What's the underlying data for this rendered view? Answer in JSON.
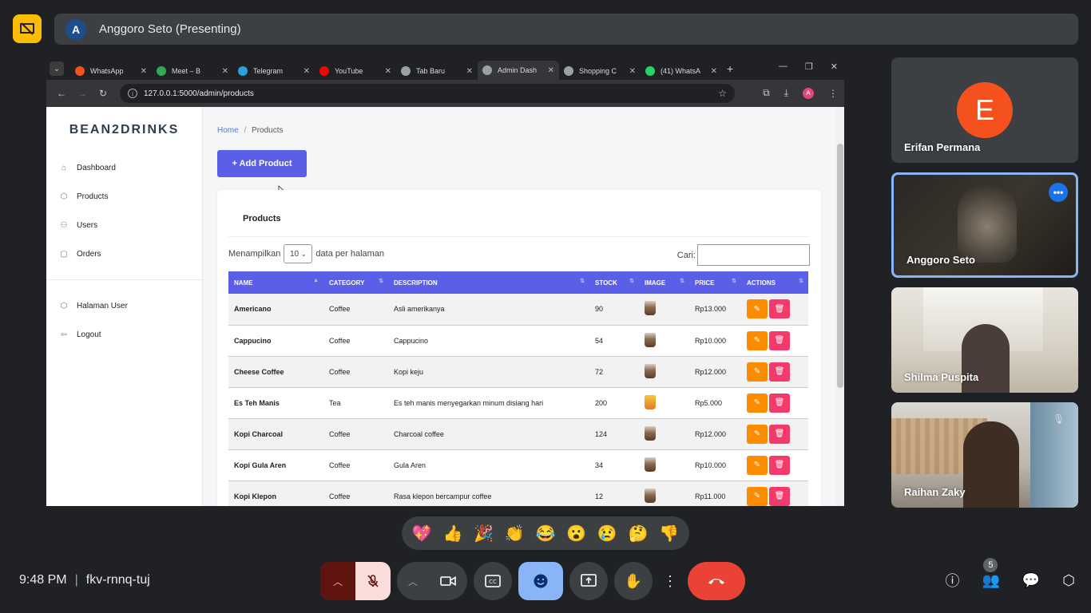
{
  "meet": {
    "presenter_initial": "A",
    "presenter_label": "Anggoro Seto (Presenting)",
    "time": "9:48 PM",
    "meeting_code": "fkv-rnnq-tuj",
    "people_count": "5"
  },
  "browser": {
    "tabs": [
      {
        "title": "WhatsApp",
        "color": "#f4511e"
      },
      {
        "title": "Meet – B",
        "color": "#34a853"
      },
      {
        "title": "Telegram",
        "color": "#2aa1da"
      },
      {
        "title": "YouTube",
        "color": "#ff0000"
      },
      {
        "title": "Tab Baru",
        "color": "#9aa0a6"
      },
      {
        "title": "Admin Dash",
        "color": "#9aa0a6",
        "active": true
      },
      {
        "title": "Shopping C",
        "color": "#9aa0a6"
      },
      {
        "title": "(41) WhatsA",
        "color": "#25d366"
      }
    ],
    "url": "127.0.0.1:5000/admin/products",
    "profile_initial": "A"
  },
  "admin": {
    "brand": "BEAN2DRINKS",
    "sidebar": {
      "items": [
        {
          "label": "Dashboard",
          "icon": "home-icon"
        },
        {
          "label": "Products",
          "icon": "box-icon"
        },
        {
          "label": "Users",
          "icon": "users-icon"
        },
        {
          "label": "Orders",
          "icon": "bag-icon"
        }
      ],
      "bottom_items": [
        {
          "label": "Halaman User",
          "icon": "box-icon"
        },
        {
          "label": "Logout",
          "icon": "logout-icon"
        }
      ]
    },
    "breadcrumb": {
      "home": "Home",
      "sep": "/",
      "current": "Products"
    },
    "add_button": "+ Add Product",
    "card_title": "Products",
    "length_prefix": "Menampilkan",
    "length_value": "10",
    "length_suffix": "data per halaman",
    "search_label": "Cari:",
    "table": {
      "headers": [
        "NAME",
        "CATEGORY",
        "DESCRIPTION",
        "STOCK",
        "IMAGE",
        "PRICE",
        "ACTIONS"
      ],
      "rows": [
        {
          "name": "Americano",
          "category": "Coffee",
          "description": "Asli amerikanya",
          "stock": "90",
          "price": "Rp13.000"
        },
        {
          "name": "Cappucino",
          "category": "Coffee",
          "description": "Cappucino",
          "stock": "54",
          "price": "Rp10.000"
        },
        {
          "name": "Cheese Coffee",
          "category": "Coffee",
          "description": "Kopi keju",
          "stock": "72",
          "price": "Rp12.000"
        },
        {
          "name": "Es Teh Manis",
          "category": "Tea",
          "description": "Es teh manis menyegarkan minum disiang hari",
          "stock": "200",
          "price": "Rp5.000"
        },
        {
          "name": "Kopi Charcoal",
          "category": "Coffee",
          "description": "Charcoal coffee",
          "stock": "124",
          "price": "Rp12.000"
        },
        {
          "name": "Kopi Gula Aren",
          "category": "Coffee",
          "description": "Gula Aren",
          "stock": "34",
          "price": "Rp10.000"
        },
        {
          "name": "Kopi Klepon",
          "category": "Coffee",
          "description": "Rasa klepon bercampur coffee",
          "stock": "12",
          "price": "Rp11.000"
        }
      ]
    }
  },
  "participants": [
    {
      "name": "Erifan Permana",
      "initial": "E"
    },
    {
      "name": "Anggoro Seto"
    },
    {
      "name": "Shilma Puspita"
    },
    {
      "name": "Raihan Zaky"
    }
  ],
  "reactions": [
    "💖",
    "👍",
    "🎉",
    "👏",
    "😂",
    "😮",
    "😢",
    "🤔",
    "👎"
  ],
  "colors": {
    "accent": "#5b5fe8",
    "edit": "#fb8c00",
    "delete": "#f33a6a",
    "end_call": "#ea4335"
  }
}
